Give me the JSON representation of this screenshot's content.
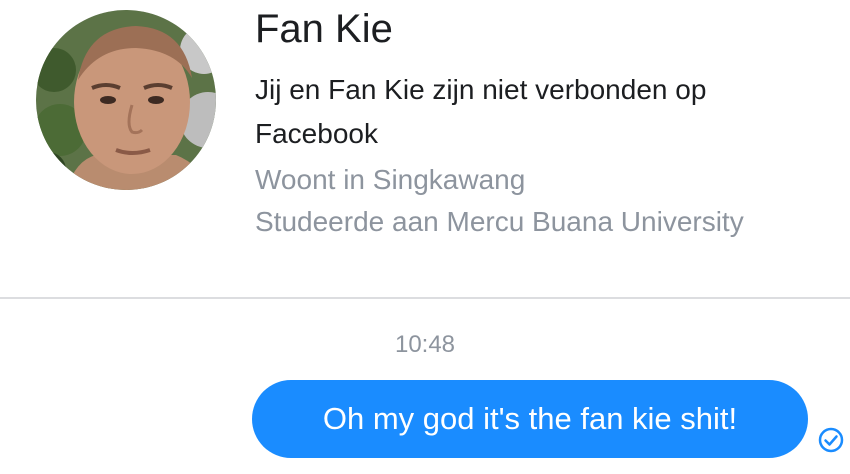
{
  "profile": {
    "name": "Fan Kie",
    "connection_text": "Jij en Fan Kie zijn niet verbonden op Facebook",
    "lives_in": "Woont in Singkawang",
    "studied_at": "Studeerde aan Mercu Buana University"
  },
  "conversation": {
    "timestamp": "10:48",
    "messages": [
      {
        "text": "Oh my god it's the fan kie shit!",
        "status_icon": "sent-check-icon"
      }
    ]
  },
  "colors": {
    "bubble": "#1a8cff",
    "secondary_text": "#8d949e",
    "primary_text": "#1c1e21",
    "divider": "#dcdde0"
  }
}
